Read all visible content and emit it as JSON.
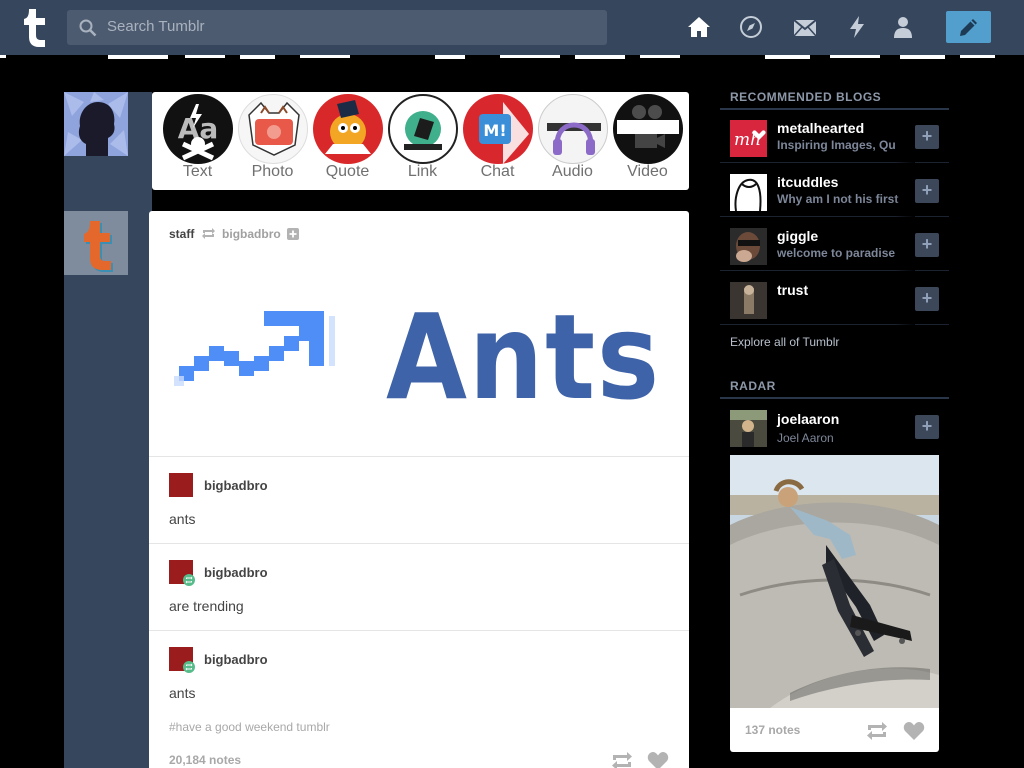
{
  "topbar": {
    "search_placeholder": "Search Tumblr",
    "icons": [
      "tumblr-logo",
      "search-icon",
      "home-icon",
      "explore-icon",
      "inbox-icon",
      "activity-icon",
      "account-icon",
      "compose-icon"
    ]
  },
  "post_types": [
    {
      "label": "Text",
      "color": "#111111"
    },
    {
      "label": "Photo",
      "color": "#e8594a"
    },
    {
      "label": "Quote",
      "color": "#d9282a"
    },
    {
      "label": "Link",
      "color": "#3fb08b"
    },
    {
      "label": "Chat",
      "color": "#d8282d"
    },
    {
      "label": "Audio",
      "color": "#8c6bc8"
    },
    {
      "label": "Video",
      "color": "#111111"
    }
  ],
  "post": {
    "author": "staff",
    "reblogged_from": "bigbadbro",
    "chain": [
      {
        "name": "bigbadbro",
        "text": "ants"
      },
      {
        "name": "bigbadbro",
        "text": "are trending"
      },
      {
        "name": "bigbadbro",
        "text": "ants"
      }
    ],
    "tags": "#have a good weekend tumblr",
    "notes": "20,184 notes"
  },
  "sidebar": {
    "recommended_heading": "RECOMMENDED BLOGS",
    "recommended": [
      {
        "name": "metalhearted",
        "desc": "Inspiring Images, Qu"
      },
      {
        "name": "itcuddles",
        "desc": "Why am I not his first"
      },
      {
        "name": "giggle",
        "desc": "welcome to paradise"
      },
      {
        "name": "trust",
        "desc": ""
      }
    ],
    "explore": "Explore all of Tumblr",
    "radar_heading": "RADAR",
    "radar": {
      "name": "joelaaron",
      "desc": "Joel Aaron",
      "notes": "137 notes"
    }
  },
  "colors": {
    "topbar": "#36465d",
    "accent": "#529ecc",
    "background": "#000000"
  }
}
